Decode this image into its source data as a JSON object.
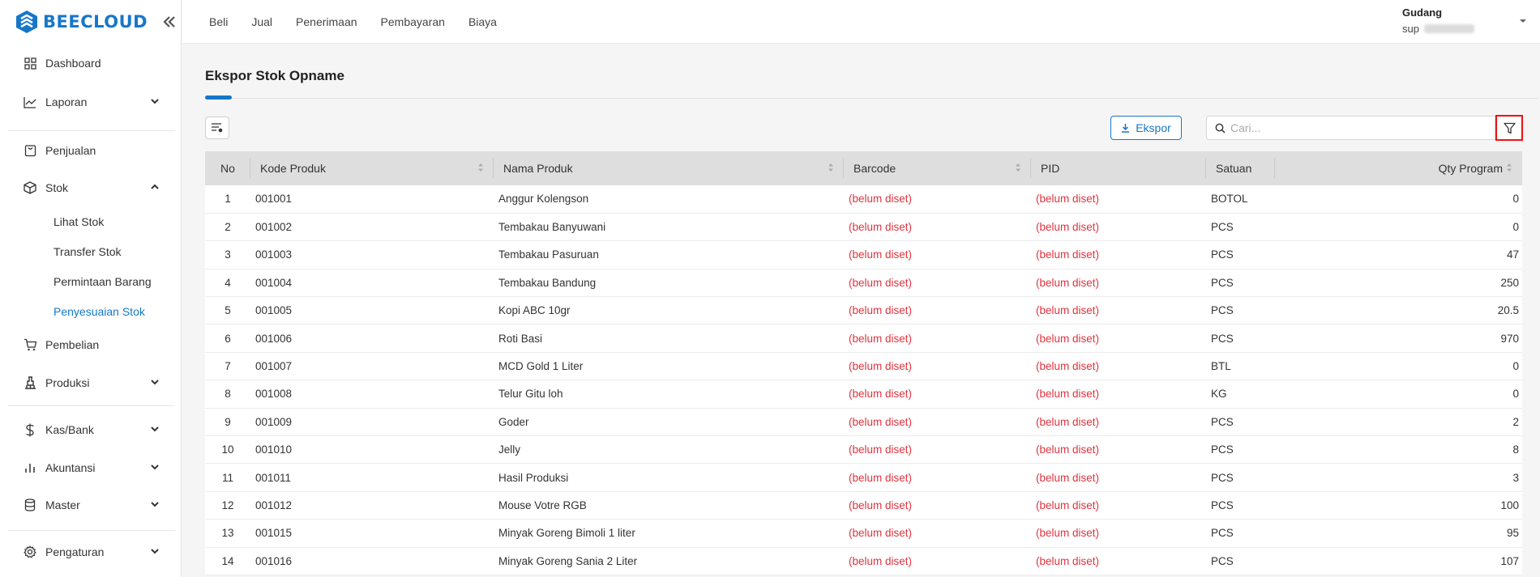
{
  "brand": {
    "name": "BEECLOUD",
    "color": "#1677c9"
  },
  "sidebar": {
    "items": [
      {
        "label": "Dashboard",
        "icon": "grid-icon"
      },
      {
        "label": "Laporan",
        "icon": "chart-line-icon"
      },
      {
        "label": "Penjualan",
        "icon": "shopping-bag-icon"
      },
      {
        "label": "Stok",
        "icon": "box-icon"
      },
      {
        "label": "Pembelian",
        "icon": "cart-icon"
      },
      {
        "label": "Produksi",
        "icon": "factory-icon"
      },
      {
        "label": "Kas/Bank",
        "icon": "dollar-icon"
      },
      {
        "label": "Akuntansi",
        "icon": "bar-chart-icon"
      },
      {
        "label": "Master",
        "icon": "database-icon"
      },
      {
        "label": "Pengaturan",
        "icon": "gear-icon"
      }
    ],
    "stok_sub": [
      "Lihat Stok",
      "Transfer Stok",
      "Permintaan Barang",
      "Penyesuaian Stok"
    ]
  },
  "topnav": [
    "Beli",
    "Jual",
    "Penerimaan",
    "Pembayaran",
    "Biaya"
  ],
  "user": {
    "role": "Gudang",
    "name": "sup"
  },
  "page": {
    "title": "Ekspor Stok Opname",
    "export_label": "Ekspor",
    "search_placeholder": "Cari..."
  },
  "table": {
    "headers": [
      "No",
      "Kode Produk",
      "Nama Produk",
      "Barcode",
      "PID",
      "Satuan",
      "Qty Program"
    ],
    "rows": [
      [
        "1",
        "001001",
        "Anggur Kolengson",
        "(belum diset)",
        "(belum diset)",
        "BOTOL",
        "0"
      ],
      [
        "2",
        "001002",
        "Tembakau Banyuwani",
        "(belum diset)",
        "(belum diset)",
        "PCS",
        "0"
      ],
      [
        "3",
        "001003",
        "Tembakau Pasuruan",
        "(belum diset)",
        "(belum diset)",
        "PCS",
        "47"
      ],
      [
        "4",
        "001004",
        "Tembakau Bandung",
        "(belum diset)",
        "(belum diset)",
        "PCS",
        "250"
      ],
      [
        "5",
        "001005",
        "Kopi ABC 10gr",
        "(belum diset)",
        "(belum diset)",
        "PCS",
        "20.5"
      ],
      [
        "6",
        "001006",
        "Roti Basi",
        "(belum diset)",
        "(belum diset)",
        "PCS",
        "970"
      ],
      [
        "7",
        "001007",
        "MCD Gold 1 Liter",
        "(belum diset)",
        "(belum diset)",
        "BTL",
        "0"
      ],
      [
        "8",
        "001008",
        "Telur Gitu loh",
        "(belum diset)",
        "(belum diset)",
        "KG",
        "0"
      ],
      [
        "9",
        "001009",
        "Goder",
        "(belum diset)",
        "(belum diset)",
        "PCS",
        "2"
      ],
      [
        "10",
        "001010",
        "Jelly",
        "(belum diset)",
        "(belum diset)",
        "PCS",
        "8"
      ],
      [
        "11",
        "001011",
        "Hasil Produksi",
        "(belum diset)",
        "(belum diset)",
        "PCS",
        "3"
      ],
      [
        "12",
        "001012",
        "Mouse Votre RGB",
        "(belum diset)",
        "(belum diset)",
        "PCS",
        "100"
      ],
      [
        "13",
        "001015",
        "Minyak Goreng Bimoli 1 liter",
        "(belum diset)",
        "(belum diset)",
        "PCS",
        "95"
      ],
      [
        "14",
        "001016",
        "Minyak Goreng Sania 2 Liter",
        "(belum diset)",
        "(belum diset)",
        "PCS",
        "107"
      ]
    ]
  }
}
